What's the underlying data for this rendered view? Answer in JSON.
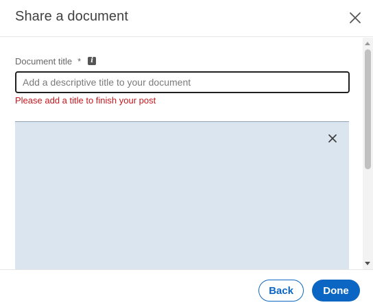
{
  "dialog": {
    "title": "Share a document"
  },
  "form": {
    "title_label": "Document title",
    "required_marker": "*",
    "input_value": "",
    "input_placeholder": "Add a descriptive title to your document",
    "error_message": "Please add a title to finish your post"
  },
  "footer": {
    "back_label": "Back",
    "done_label": "Done"
  },
  "colors": {
    "accent": "#0a66c2",
    "error": "#c4161c",
    "preview_bg": "#dbe5ef"
  },
  "icons": {
    "close": "close-icon",
    "info": "info-icon",
    "remove_document": "close-icon"
  }
}
